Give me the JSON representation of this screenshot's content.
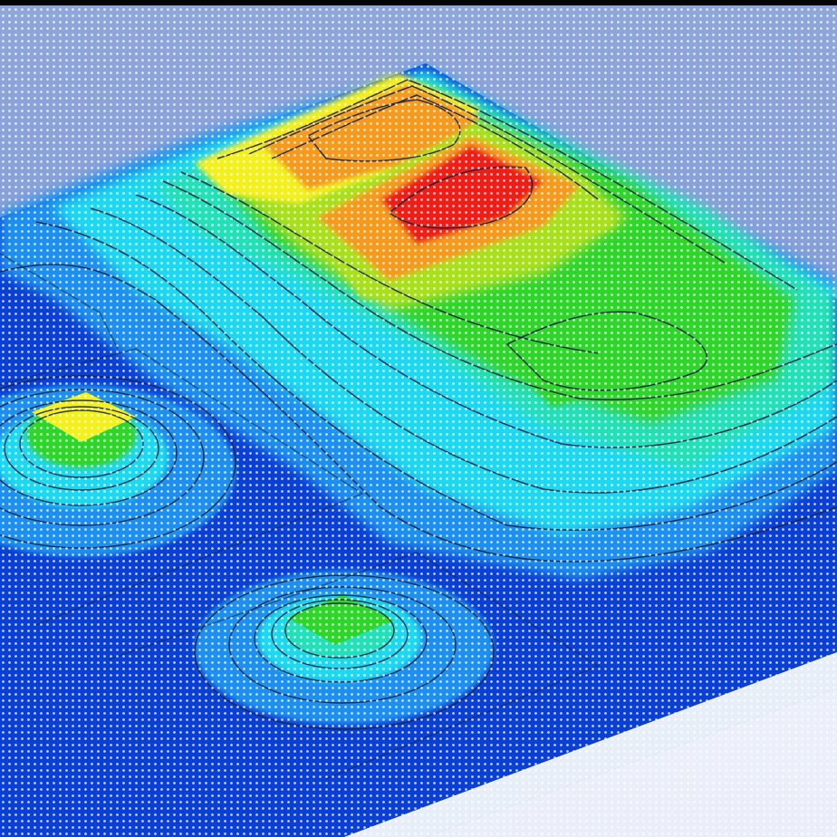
{
  "image": {
    "subject": "simulation-contour-rendering",
    "colors": {
      "background_top": "#8fa6d8",
      "background_bottom": "#6f8fd6",
      "frame": "#050505",
      "low": "#0a3fd6",
      "low_mid": "#1f8ff0",
      "cyan": "#1fd8f0",
      "teal": "#22e0b8",
      "green": "#2fd62a",
      "yellow_green": "#a8e01e",
      "yellow": "#f3f01a",
      "orange": "#f59a1a",
      "red": "#f01e12",
      "contour_line": "#1a2340",
      "dot_grid": "#ffffff",
      "slab_edge": "#e8eef8"
    },
    "regions": [
      {
        "name": "main-hotspot-ridge",
        "level": "high"
      },
      {
        "name": "left-small-peak",
        "level": "medium-high"
      },
      {
        "name": "front-small-peak",
        "level": "medium"
      }
    ]
  }
}
